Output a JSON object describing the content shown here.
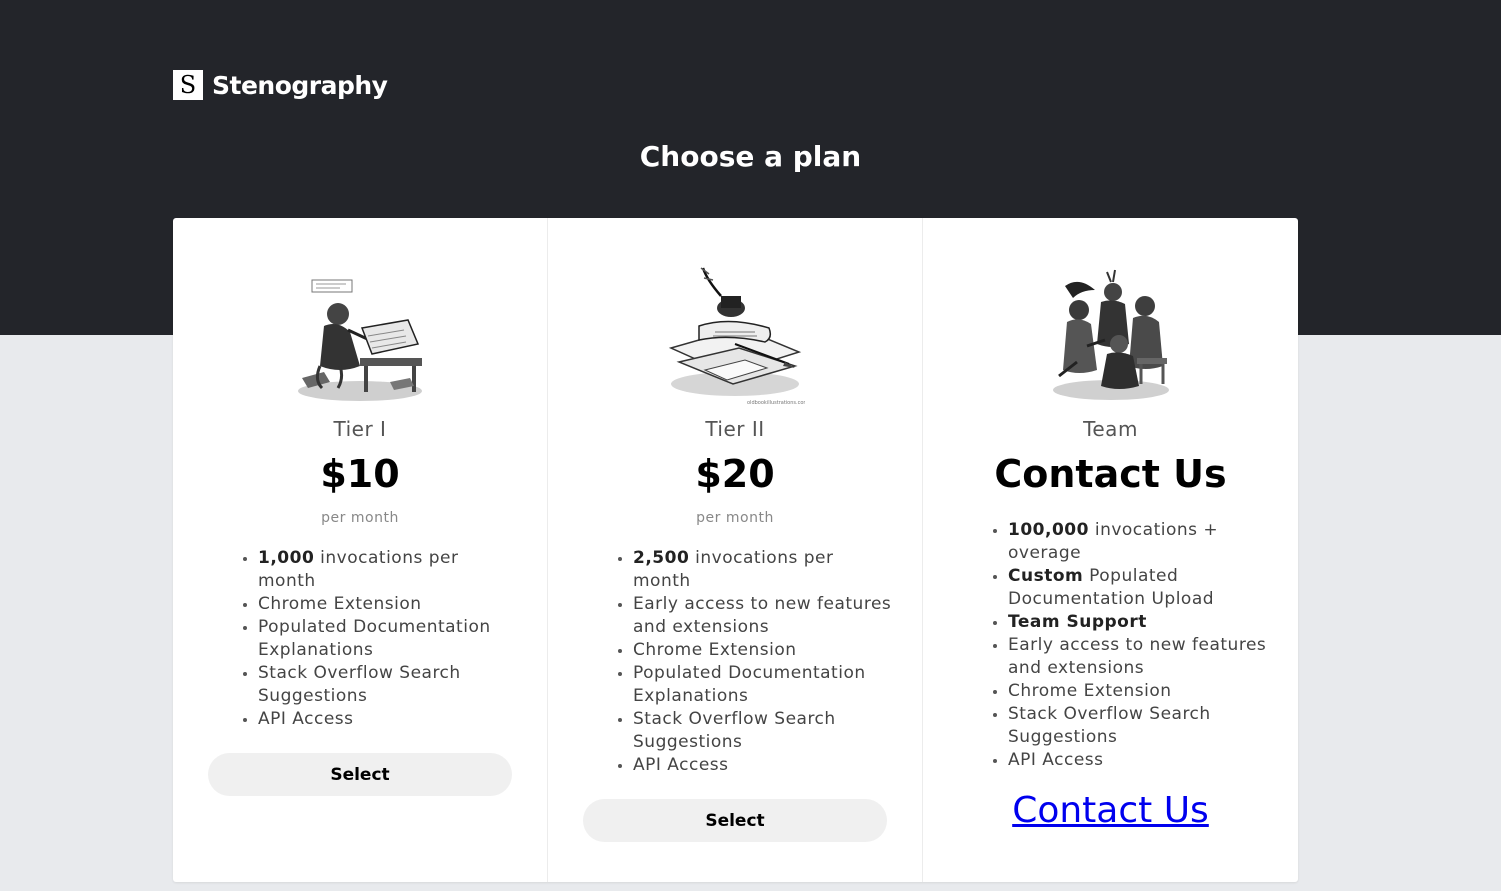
{
  "brand": {
    "logo_letter": "S",
    "name": "Stenography"
  },
  "page_title": "Choose a plan",
  "plans": [
    {
      "tier": "Tier I",
      "price": "$10",
      "period": "per month",
      "features": [
        {
          "bold": "1,000",
          "text": " invocations per month"
        },
        {
          "bold": "",
          "text": "Chrome Extension"
        },
        {
          "bold": "",
          "text": "Populated Documentation Explanations"
        },
        {
          "bold": "",
          "text": "Stack Overflow Search Suggestions"
        },
        {
          "bold": "",
          "text": "API Access"
        }
      ],
      "button_label": "Select",
      "illustration": "scribe-at-desk-illustration"
    },
    {
      "tier": "Tier II",
      "price": "$20",
      "period": "per month",
      "features": [
        {
          "bold": "2,500",
          "text": " invocations per month"
        },
        {
          "bold": "",
          "text": "Early access to new features and extensions"
        },
        {
          "bold": "",
          "text": "Chrome Extension"
        },
        {
          "bold": "",
          "text": "Populated Documentation Explanations"
        },
        {
          "bold": "",
          "text": "Stack Overflow Search Suggestions"
        },
        {
          "bold": "",
          "text": "API Access"
        }
      ],
      "button_label": "Select",
      "illustration": "quill-and-papers-illustration"
    },
    {
      "tier": "Team",
      "price": "Contact Us",
      "features": [
        {
          "bold": "100,000",
          "text": " invocations + overage"
        },
        {
          "bold": "Custom",
          "text": " Populated Documentation Upload"
        },
        {
          "bold": "Team Support",
          "text": ""
        },
        {
          "bold": "",
          "text": "Early access to new features and extensions"
        },
        {
          "bold": "",
          "text": "Chrome Extension"
        },
        {
          "bold": "",
          "text": "Stack Overflow Search Suggestions"
        },
        {
          "bold": "",
          "text": "API Access"
        }
      ],
      "link_label": "Contact Us",
      "illustration": "group-of-people-illustration"
    }
  ],
  "colors": {
    "hero_bg": "#23252a",
    "page_bg": "#e8eaed",
    "card_bg": "#ffffff",
    "button_bg": "#f0f0f0",
    "link": "#0000ee"
  }
}
